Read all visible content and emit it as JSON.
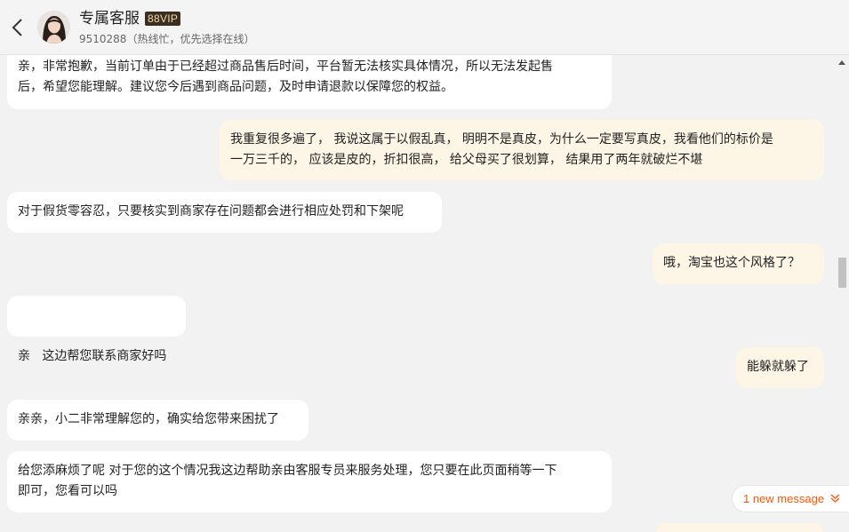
{
  "header": {
    "title": "专属客服",
    "badge": "88VIP",
    "subtitle": "9510288（热线忙，优先选择在线）",
    "back_icon": "back-arrow-icon"
  },
  "messages": [
    {
      "from": "agent",
      "lines": [
        "亲，非常抱歉，当前订单由于已经超过商品售后时间，平台暂无法核实具体情况，所以无法发起售",
        "后，希望您能理解。建议您今后遇到商品问题，及时申请退款以保障您的权益。"
      ]
    },
    {
      "from": "user",
      "lines": [
        "我重复很多遍了， 我说这属于以假乱真， 明明不是真皮，为什么一定要写真皮，我看他们的标价是",
        "一万三千的， 应该是皮的，折扣很高， 给父母买了很划算， 结果用了两年就破烂不堪"
      ]
    },
    {
      "from": "agent",
      "lines": [
        "对于假货零容忍，只要核实到商家存在问题都会进行相应处罚和下架呢"
      ]
    },
    {
      "from": "user",
      "lines": [
        "哦，淘宝也这个风格了？"
      ]
    },
    {
      "from": "agent",
      "lines": [
        "亲   这边帮您联系商家好吗"
      ]
    },
    {
      "from": "user",
      "lines": [
        "能躲就躲了"
      ]
    },
    {
      "from": "agent",
      "lines": [
        "亲亲，小二非常理解您的，确实给您带来困扰了"
      ]
    },
    {
      "from": "agent",
      "lines": [
        "给您添麻烦了呢 对于您的这个情况我这边帮助亲由客服专员来服务处理，您只要在此页面稍等一下",
        "即可，您看可以吗"
      ]
    }
  ],
  "new_message": {
    "label": "1 new message",
    "icon": "double-chevron-down-icon"
  },
  "colors": {
    "agent_bubble": "#ffffff",
    "user_bubble": "#fdf5e6",
    "accent": "#ff5500",
    "badge_bg": "#3a2f21",
    "badge_text": "#f3d9a4"
  }
}
